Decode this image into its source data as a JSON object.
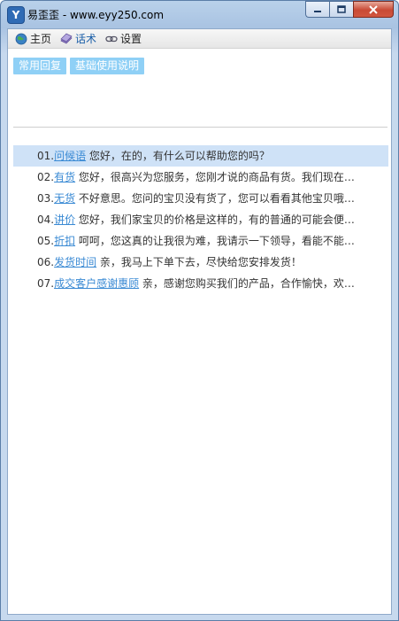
{
  "window": {
    "title": "易歪歪 - www.eyy250.com",
    "icon_letter": "Y"
  },
  "nav": {
    "items": [
      {
        "label": "主页",
        "icon": "globe-icon"
      },
      {
        "label": "话术",
        "icon": "book-icon",
        "active": true
      },
      {
        "label": "设置",
        "icon": "link-icon"
      }
    ]
  },
  "toolbar": {
    "common_reply": "常用回复",
    "basic_help": "基础使用说明"
  },
  "replies": [
    {
      "num": "01.",
      "keyword": "问候语",
      "text": " 您好，在的，有什么可以帮助您的吗？",
      "selected": true
    },
    {
      "num": "02.",
      "keyword": "有货",
      "text": " 您好，很高兴为您服务，您刚才说的商品有货。我们现在…"
    },
    {
      "num": "03.",
      "keyword": "无货",
      "text": " 不好意思。您问的宝贝没有货了，您可以看看其他宝贝哦…"
    },
    {
      "num": "04.",
      "keyword": "讲价",
      "text": " 您好，我们家宝贝的价格是这样的，有的普通的可能会便…"
    },
    {
      "num": "05.",
      "keyword": "折扣",
      "text": " 呵呵，您这真的让我很为难，我请示一下领导，看能不能…"
    },
    {
      "num": "06.",
      "keyword": "发货时间",
      "text": " 亲，我马上下单下去，尽快给您安排发货！"
    },
    {
      "num": "07.",
      "keyword": "成交客户感谢惠顾",
      "text": " 亲，感谢您购买我们的产品，合作愉快，欢…"
    }
  ],
  "colors": {
    "button_bg": "#8fd0f6",
    "selected_row": "#cfe2f7",
    "keyword_link": "#3a8ad4"
  }
}
